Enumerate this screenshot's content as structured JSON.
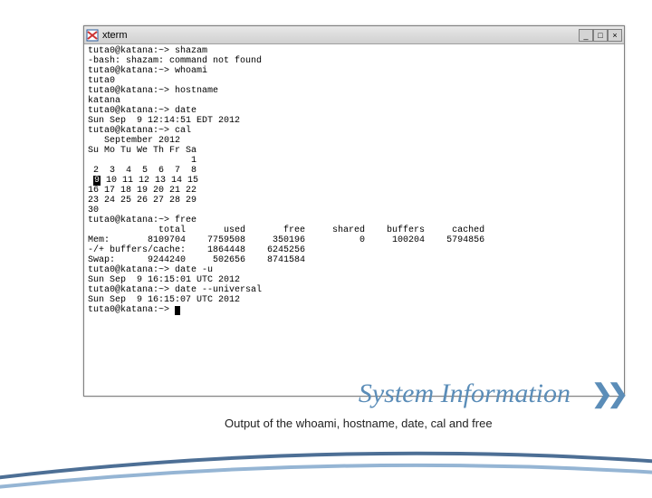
{
  "window": {
    "title": "xterm"
  },
  "terminal": {
    "lines": [
      "tuta0@katana:~> shazam",
      "-bash: shazam: command not found",
      "tuta0@katana:~> whoami",
      "tuta0",
      "tuta0@katana:~> hostname",
      "katana",
      "tuta0@katana:~> date",
      "Sun Sep  9 12:14:51 EDT 2012",
      "tuta0@katana:~> cal",
      "   September 2012",
      "Su Mo Tu We Th Fr Sa",
      "                   1",
      " 2  3  4  5  6  7  8",
      " 9 10 11 12 13 14 15",
      "16 17 18 19 20 21 22",
      "23 24 25 26 27 28 29",
      "30",
      "tuta0@katana:~> free",
      "             total       used       free     shared    buffers     cached",
      "Mem:       8109704    7759508     350196          0     100204    5794856",
      "-/+ buffers/cache:    1864448    6245256",
      "Swap:      9244240     502656    8741584",
      "tuta0@katana:~> date -u",
      "Sun Sep  9 16:15:01 UTC 2012",
      "tuta0@katana:~> date --universal",
      "Sun Sep  9 16:15:07 UTC 2012",
      "tuta0@katana:~> "
    ],
    "cal_today_row_index": 13,
    "cal_today_prefix": " ",
    "cal_today_day": "9",
    "cal_today_rest": " 10 11 12 13 14 15"
  },
  "slide": {
    "title": "System Information",
    "caption": "Output of the whoami, hostname, date,  cal and free",
    "chevrons": "❯❯"
  },
  "titlebar_buttons": {
    "min": "_",
    "max": "□",
    "close": "×"
  }
}
